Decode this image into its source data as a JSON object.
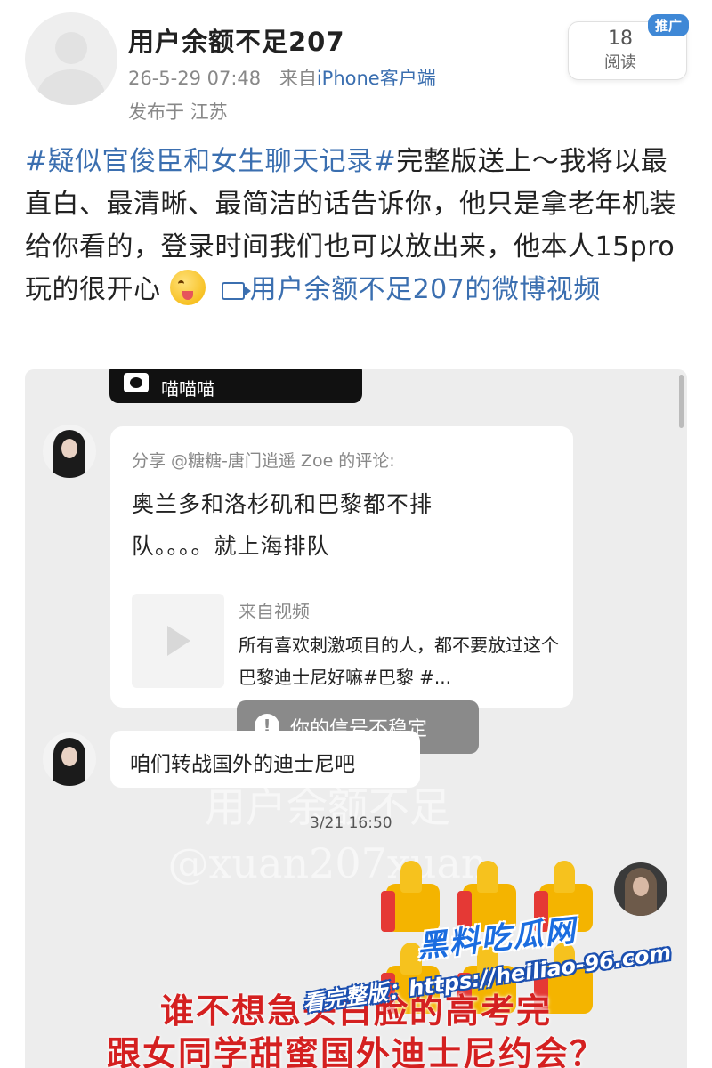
{
  "post": {
    "username": "用户余额不足207",
    "timestamp": "26-5-29 07:48",
    "source_prefix": "来自",
    "source": "iPhone客户端",
    "location": "发布于 江苏",
    "read_count": "18",
    "read_label": "阅读",
    "promo_badge": "推广",
    "topic": "#疑似官俊臣和女生聊天记录#",
    "body": "完整版送上～我将以最直白、最清晰、最简洁的话告诉你，他只是拿老年机装给你看的，登录时间我们也可以放出来，他本人15pro玩的很开心",
    "video_link": "用户余额不足207的微博视频",
    "emoji": "grinning-tongue-emoji",
    "video_icon": "video-icon"
  },
  "screenshot": {
    "top_bar_name": "喵喵喵",
    "share_title": "分享 @糖糖-唐门逍遥 Zoe 的评论:",
    "share_quote": "奥兰多和洛杉矶和巴黎都不排队。。。。就上海排队",
    "video_from": "来自视频",
    "video_desc": "所有喜欢刺激项目的人，都不要放过这个巴黎迪士尼好嘛#巴黎 #...",
    "signal_toast": "你的信号不稳定",
    "message": "咱们转战国外的迪士尼吧",
    "watermark_line1": "用户余额不足",
    "watermark_line2": "@xuan207xuan",
    "time_label": "3/21 16:50",
    "caption_line1": "谁不想急头白脸的高考完",
    "caption_line2": "跟女同学甜蜜国外迪士尼约会？",
    "brand_logo": "黑料吃瓜网",
    "promo_url": "看完整版：https://heiliao-96.com"
  },
  "colors": {
    "link_blue": "#3b6fb0",
    "caption_red": "#d42020",
    "badge_blue": "#3f88d6"
  }
}
